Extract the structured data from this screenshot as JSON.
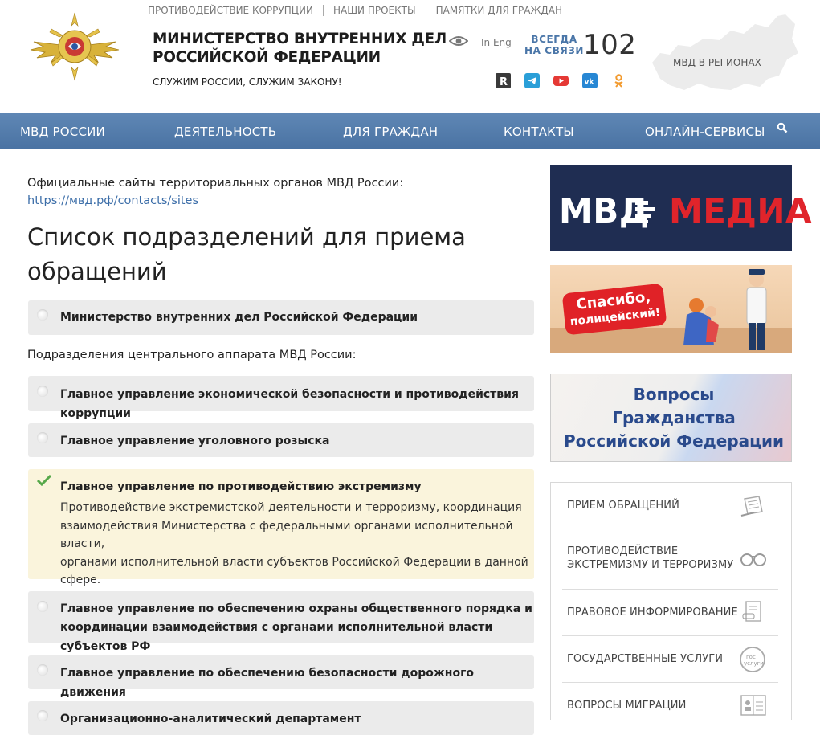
{
  "top_links": [
    "ПРОТИВОДЕЙСТВИЕ КОРРУПЦИИ",
    "НАШИ ПРОЕКТЫ",
    "ПАМЯТКИ ДЛЯ ГРАЖДАН"
  ],
  "header": {
    "title_line1": "МИНИСТЕРСТВО ВНУТРЕННИХ ДЕЛ",
    "title_line2": "РОССИЙСКОЙ ФЕДЕРАЦИИ",
    "motto": "СЛУЖИМ РОССИИ, СЛУЖИМ ЗАКОНУ!",
    "lang": "In Eng",
    "always_line1": "ВСЕГДА",
    "always_line2": "НА СВЯЗИ",
    "phone": "102",
    "regions": "МВД В РЕГИОНАХ"
  },
  "social_icons": [
    "rutube-icon",
    "telegram-icon",
    "youtube-icon",
    "vk-icon",
    "odnoklassniki-icon"
  ],
  "nav": [
    "МВД РОССИИ",
    "ДЕЯТЕЛЬНОСТЬ",
    "ДЛЯ ГРАЖДАН",
    "КОНТАКТЫ",
    "ОНЛАЙН-СЕРВИСЫ"
  ],
  "main": {
    "intro": "Официальные сайты территориальных органов МВД России:",
    "intro_link": "https://мвд.рф/contacts/sites",
    "heading_line1": "Список подразделений для приема",
    "heading_line2": "обращений",
    "first_item": "Министерство внутренних дел Российской Федерации",
    "subheading": "Подразделения центрального аппарата МВД России:",
    "items": [
      {
        "title": "Главное управление экономической безопасности и противодействия коррупции"
      },
      {
        "title": "Главное управление уголовного розыска"
      },
      {
        "title": "Главное управление по противодействию экстремизму",
        "selected": true,
        "desc": [
          "Противодействие экстремистской деятельности и терроризму, координация",
          "взаимодействия Министерства с федеральными органами исполнительной власти,",
          "органами исполнительной власти субъектов Российской Федерации в данной",
          "сфере."
        ]
      },
      {
        "title_line1": "Главное управление по обеспечению охраны общественного порядка и",
        "title_line2": "координации взаимодействия с органами исполнительной власти субъектов РФ"
      },
      {
        "title": "Главное управление по обеспечению безопасности дорожного движения"
      },
      {
        "title": "Организационно-аналитический департамент"
      }
    ]
  },
  "sidebar": {
    "banner_media": [
      "МВД",
      "МЕДИА"
    ],
    "banner_thanks": [
      "Спасибо,",
      "полицейский!"
    ],
    "banner_citizenship": [
      "Вопросы",
      "Гражданства",
      "Российской Федерации"
    ],
    "menu": [
      {
        "label": "ПРИЕМ ОБРАЩЕНИЙ",
        "icon": "document-pen-icon"
      },
      {
        "label_line1": "ПРОТИВОДЕЙСТВИЕ",
        "label_line2": "ЭКСТРЕМИЗМУ И ТЕРРОРИЗМУ",
        "icon": "handcuffs-icon"
      },
      {
        "label": "ПРАВОВОЕ ИНФОРМИРОВАНИЕ",
        "icon": "legal-document-icon"
      },
      {
        "label": "ГОСУДАРСТВЕННЫЕ УСЛУГИ",
        "icon": "gosuslugi-icon",
        "icon_text": [
          "гос",
          "услуги"
        ]
      },
      {
        "label": "ВОПРОСЫ МИГРАЦИИ",
        "icon": "passport-icon"
      }
    ]
  }
}
